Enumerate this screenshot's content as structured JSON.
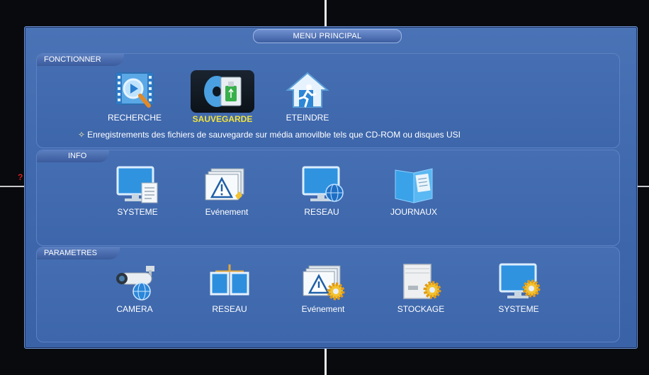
{
  "window": {
    "title": "MENU PRINCIPAL"
  },
  "sections": {
    "fonctionner": {
      "label": "FONCTIONNER",
      "items": [
        {
          "label": "RECHERCHE",
          "icon": "film-search-icon"
        },
        {
          "label": "SAUVEGARDE",
          "icon": "backup-usb-icon",
          "selected": true
        },
        {
          "label": "ETEINDRE",
          "icon": "house-exit-icon"
        }
      ],
      "hint": "Enregistrements des fichiers de sauvegarde sur média amovilble tels que CD-ROM ou disques USI"
    },
    "info": {
      "label": "INFO",
      "items": [
        {
          "label": "SYSTEME",
          "icon": "monitor-document-icon"
        },
        {
          "label": "Evénement",
          "icon": "warning-event-icon"
        },
        {
          "label": "RESEAU",
          "icon": "monitor-globe-icon"
        },
        {
          "label": "JOURNAUX",
          "icon": "log-book-icon"
        }
      ]
    },
    "parametres": {
      "label": "PARAMETRES",
      "items": [
        {
          "label": "CAMERA",
          "icon": "camera-globe-icon"
        },
        {
          "label": "RESEAU",
          "icon": "network-monitors-icon"
        },
        {
          "label": "Evénement",
          "icon": "warning-gear-icon"
        },
        {
          "label": "STOCKAGE",
          "icon": "storage-gear-icon"
        },
        {
          "label": "SYSTEME",
          "icon": "monitor-gear-icon"
        }
      ]
    }
  },
  "colors": {
    "accent_selected": "#f2e23a",
    "window_blue": "#3f68ad",
    "text": "#ffffff"
  }
}
